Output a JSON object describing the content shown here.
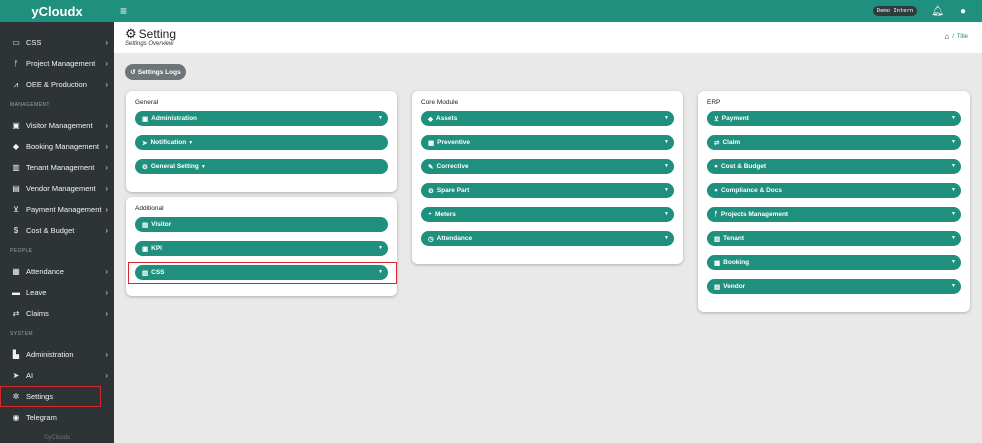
{
  "brand": "yCloudx",
  "sidebar": {
    "items": [
      {
        "key": "css",
        "label": "CSS",
        "icon": "monitor-icon",
        "glyph": "▭",
        "chev": true
      },
      {
        "key": "project-management",
        "label": "Project Management",
        "icon": "project-icon",
        "glyph": "ᚠ",
        "chev": true
      },
      {
        "key": "oee-production",
        "label": "OEE & Production",
        "icon": "chart-line-icon",
        "glyph": "⩘",
        "chev": true
      }
    ],
    "section_management": "MANAGEMENT",
    "management": [
      {
        "key": "visitor-management",
        "label": "Visitor Management",
        "icon": "id-card-icon",
        "glyph": "▣",
        "chev": true
      },
      {
        "key": "booking-management",
        "label": "Booking Management",
        "icon": "tag-icon",
        "glyph": "◆",
        "chev": true
      },
      {
        "key": "tenant-management",
        "label": "Tenant Management",
        "icon": "building-icon",
        "glyph": "▥",
        "chev": true
      },
      {
        "key": "vendor-management",
        "label": "Vendor Management",
        "icon": "address-card-icon",
        "glyph": "▤",
        "chev": true
      },
      {
        "key": "payment-management",
        "label": "Payment Management",
        "icon": "cart-icon",
        "glyph": "⊻",
        "chev": true
      },
      {
        "key": "cost-budget",
        "label": "Cost & Budget",
        "icon": "dollar-icon",
        "glyph": "$",
        "chev": true
      }
    ],
    "section_people": "PEOPLE",
    "people": [
      {
        "key": "attendance",
        "label": "Attendance",
        "icon": "clipboard-icon",
        "glyph": "▦",
        "chev": true
      },
      {
        "key": "leave",
        "label": "Leave",
        "icon": "bed-icon",
        "glyph": "▬",
        "chev": true
      },
      {
        "key": "claims",
        "label": "Claims",
        "icon": "exchange-icon",
        "glyph": "⇄",
        "chev": true
      }
    ],
    "section_system": "SYSTEM",
    "system": [
      {
        "key": "administration",
        "label": "Administration",
        "icon": "user-shield-icon",
        "glyph": "▙",
        "chev": true
      },
      {
        "key": "ai",
        "label": "AI",
        "icon": "paper-plane-icon",
        "glyph": "➤",
        "chev": true
      },
      {
        "key": "settings",
        "label": "Settings",
        "icon": "gear-icon",
        "glyph": "✲",
        "chev": false
      },
      {
        "key": "telegram",
        "label": "Telegram",
        "icon": "telegram-icon",
        "glyph": "◉",
        "chev": false
      }
    ],
    "footer": "©yCloudx"
  },
  "topbar": {
    "user": "Demo Intern"
  },
  "header": {
    "title": "Setting",
    "subtitle": "Settings Overview",
    "breadcrumb_sep": "/",
    "breadcrumb_current": "Title"
  },
  "logs_button": "Settings Logs",
  "cards": {
    "general": {
      "title": "General",
      "items": [
        {
          "label": "Administration",
          "glyph": "▣",
          "icon": "user-shield-icon",
          "caret": "right"
        },
        {
          "label": "Notification",
          "glyph": "➤",
          "icon": "paper-plane-icon",
          "caret": "inline"
        },
        {
          "label": "General Setting",
          "glyph": "⚙",
          "icon": "gears-icon",
          "caret": "inline"
        }
      ]
    },
    "additional": {
      "title": "Additional",
      "items": [
        {
          "label": "Visitor",
          "glyph": "▤",
          "icon": "id-card-icon",
          "caret": "none"
        },
        {
          "label": "KPI",
          "glyph": "▣",
          "icon": "kpi-icon",
          "caret": "right"
        },
        {
          "label": "CSS",
          "glyph": "▥",
          "icon": "file-icon",
          "caret": "right"
        }
      ]
    },
    "core": {
      "title": "Core Module",
      "items": [
        {
          "label": "Assets",
          "glyph": "◆",
          "icon": "tag-icon",
          "caret": "right"
        },
        {
          "label": "Preventive",
          "glyph": "▦",
          "icon": "calendar-icon",
          "caret": "right"
        },
        {
          "label": "Corrective",
          "glyph": "✎",
          "icon": "wrench-icon",
          "caret": "right"
        },
        {
          "label": "Spare Part",
          "glyph": "⚙",
          "icon": "spare-part-icon",
          "caret": "right"
        },
        {
          "label": "Meters",
          "glyph": "◓",
          "icon": "gauge-icon",
          "caret": "right"
        },
        {
          "label": "Attendance",
          "glyph": "◷",
          "icon": "clock-icon",
          "caret": "right"
        }
      ]
    },
    "erp": {
      "title": "ERP",
      "items": [
        {
          "label": "Payment",
          "glyph": "⊻",
          "icon": "cart-icon",
          "caret": "right"
        },
        {
          "label": "Claim",
          "glyph": "⇄",
          "icon": "exchange-icon",
          "caret": "right"
        },
        {
          "label": "Cost & Budget",
          "glyph": "●",
          "icon": "coins-icon",
          "caret": "right"
        },
        {
          "label": "Compliance & Docs",
          "glyph": "●",
          "icon": "check-circle-icon",
          "caret": "right"
        },
        {
          "label": "Projects Management",
          "glyph": "ᚠ",
          "icon": "project-icon",
          "caret": "right"
        },
        {
          "label": "Tenant",
          "glyph": "▥",
          "icon": "building-icon",
          "caret": "right"
        },
        {
          "label": "Booking",
          "glyph": "▦",
          "icon": "booking-icon",
          "caret": "right"
        },
        {
          "label": "Vendor",
          "glyph": "▤",
          "icon": "address-card-icon",
          "caret": "right"
        }
      ]
    }
  },
  "colors": {
    "accent": "#1f8f7e",
    "sidebar": "#2e3436",
    "highlight": "#d62828"
  }
}
